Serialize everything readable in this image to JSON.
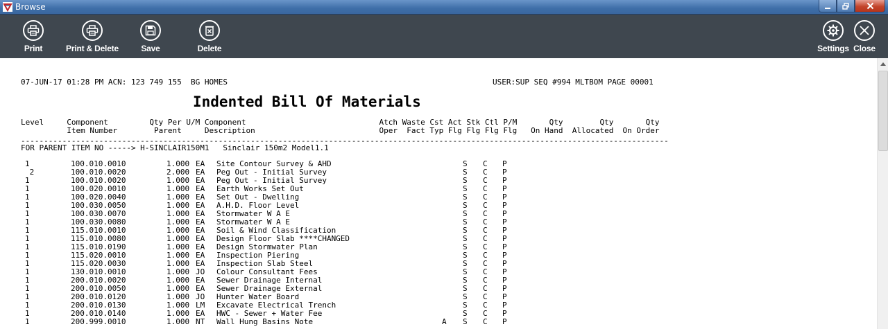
{
  "window": {
    "title": "Browse",
    "controls": {
      "minimize": "–",
      "maximize": "□",
      "close": "✕"
    }
  },
  "toolbar": {
    "print_label": "Print",
    "print_delete_label": "Print & Delete",
    "save_label": "Save",
    "delete_label": "Delete",
    "settings_label": "Settings",
    "close_label": "Close"
  },
  "report": {
    "header_left": "07-JUN-17 01:28 PM ACN: 123 749 155  BG HOMES",
    "header_right": "USER:SUP SEQ #994 MLTBOM PAGE 00001",
    "title": "Indented Bill Of Materials",
    "columns_line1": "Level     Component         Qty Per U/M Component                             Atch Waste Cst Act Stk Ctl P/M       Qty        Qty       Qty",
    "columns_line2": "          Item Number        Parent     Description                           Oper  Fact Typ Flg Flg Flg Flg   On Hand  Allocated  On Order",
    "divider": "---------------------------------------------------------------------------------------------------------------------------------------------",
    "parent_line": "FOR PARENT ITEM NO -----> H-SINCLAIR150M1   Sinclair 150m2 Model1.1",
    "rows": [
      {
        "level": "1",
        "item": "100.010.0010",
        "qty": "1.000",
        "um": "EA",
        "desc": "Site Contour Survey & AHD",
        "act": "",
        "stk": "S",
        "ctl": "C",
        "pm": "P"
      },
      {
        "level": " 2",
        "item": "100.010.0020",
        "qty": "2.000",
        "um": "EA",
        "desc": "Peg Out - Initial Survey",
        "act": "",
        "stk": "S",
        "ctl": "C",
        "pm": "P"
      },
      {
        "level": "1",
        "item": "100.010.0020",
        "qty": "1.000",
        "um": "EA",
        "desc": "Peg Out - Initial Survey",
        "act": "",
        "stk": "S",
        "ctl": "C",
        "pm": "P"
      },
      {
        "level": "1",
        "item": "100.020.0010",
        "qty": "1.000",
        "um": "EA",
        "desc": "Earth Works Set Out",
        "act": "",
        "stk": "S",
        "ctl": "C",
        "pm": "P"
      },
      {
        "level": "1",
        "item": "100.020.0040",
        "qty": "1.000",
        "um": "EA",
        "desc": "Set Out - Dwelling",
        "act": "",
        "stk": "S",
        "ctl": "C",
        "pm": "P"
      },
      {
        "level": "1",
        "item": "100.030.0050",
        "qty": "1.000",
        "um": "EA",
        "desc": "A.H.D. Floor Level",
        "act": "",
        "stk": "S",
        "ctl": "C",
        "pm": "P"
      },
      {
        "level": "1",
        "item": "100.030.0070",
        "qty": "1.000",
        "um": "EA",
        "desc": "Stormwater W A E",
        "act": "",
        "stk": "S",
        "ctl": "C",
        "pm": "P"
      },
      {
        "level": "1",
        "item": "100.030.0080",
        "qty": "1.000",
        "um": "EA",
        "desc": "Stormwater W A E",
        "act": "",
        "stk": "S",
        "ctl": "C",
        "pm": "P"
      },
      {
        "level": "1",
        "item": "115.010.0010",
        "qty": "1.000",
        "um": "EA",
        "desc": "Soil & Wind Classification",
        "act": "",
        "stk": "S",
        "ctl": "C",
        "pm": "P"
      },
      {
        "level": "1",
        "item": "115.010.0080",
        "qty": "1.000",
        "um": "EA",
        "desc": "Design Floor Slab ****CHANGED",
        "act": "",
        "stk": "S",
        "ctl": "C",
        "pm": "P"
      },
      {
        "level": "1",
        "item": "115.010.0190",
        "qty": "1.000",
        "um": "EA",
        "desc": "Design Stormwater Plan",
        "act": "",
        "stk": "S",
        "ctl": "C",
        "pm": "P"
      },
      {
        "level": "1",
        "item": "115.020.0010",
        "qty": "1.000",
        "um": "EA",
        "desc": "Inspection Piering",
        "act": "",
        "stk": "S",
        "ctl": "C",
        "pm": "P"
      },
      {
        "level": "1",
        "item": "115.020.0030",
        "qty": "1.000",
        "um": "EA",
        "desc": "Inspection Slab Steel",
        "act": "",
        "stk": "S",
        "ctl": "C",
        "pm": "P"
      },
      {
        "level": "1",
        "item": "130.010.0010",
        "qty": "1.000",
        "um": "JO",
        "desc": "Colour Consultant Fees",
        "act": "",
        "stk": "S",
        "ctl": "C",
        "pm": "P"
      },
      {
        "level": "1",
        "item": "200.010.0020",
        "qty": "1.000",
        "um": "EA",
        "desc": "Sewer Drainage Internal",
        "act": "",
        "stk": "S",
        "ctl": "C",
        "pm": "P"
      },
      {
        "level": "1",
        "item": "200.010.0050",
        "qty": "1.000",
        "um": "EA",
        "desc": "Sewer Drainage External",
        "act": "",
        "stk": "S",
        "ctl": "C",
        "pm": "P"
      },
      {
        "level": "1",
        "item": "200.010.0120",
        "qty": "1.000",
        "um": "JO",
        "desc": "Hunter Water Board",
        "act": "",
        "stk": "S",
        "ctl": "C",
        "pm": "P"
      },
      {
        "level": "1",
        "item": "200.010.0130",
        "qty": "1.000",
        "um": "LM",
        "desc": "Excavate Electrical Trench",
        "act": "",
        "stk": "S",
        "ctl": "C",
        "pm": "P"
      },
      {
        "level": "1",
        "item": "200.010.0140",
        "qty": "1.000",
        "um": "EA",
        "desc": "HWC - Sewer + Water Fee",
        "act": "",
        "stk": "S",
        "ctl": "C",
        "pm": "P"
      },
      {
        "level": "1",
        "item": "200.999.0010",
        "qty": "1.000",
        "um": "NT",
        "desc": "Wall Hung Basins Note",
        "act": "A",
        "stk": "S",
        "ctl": "C",
        "pm": "P"
      }
    ]
  }
}
